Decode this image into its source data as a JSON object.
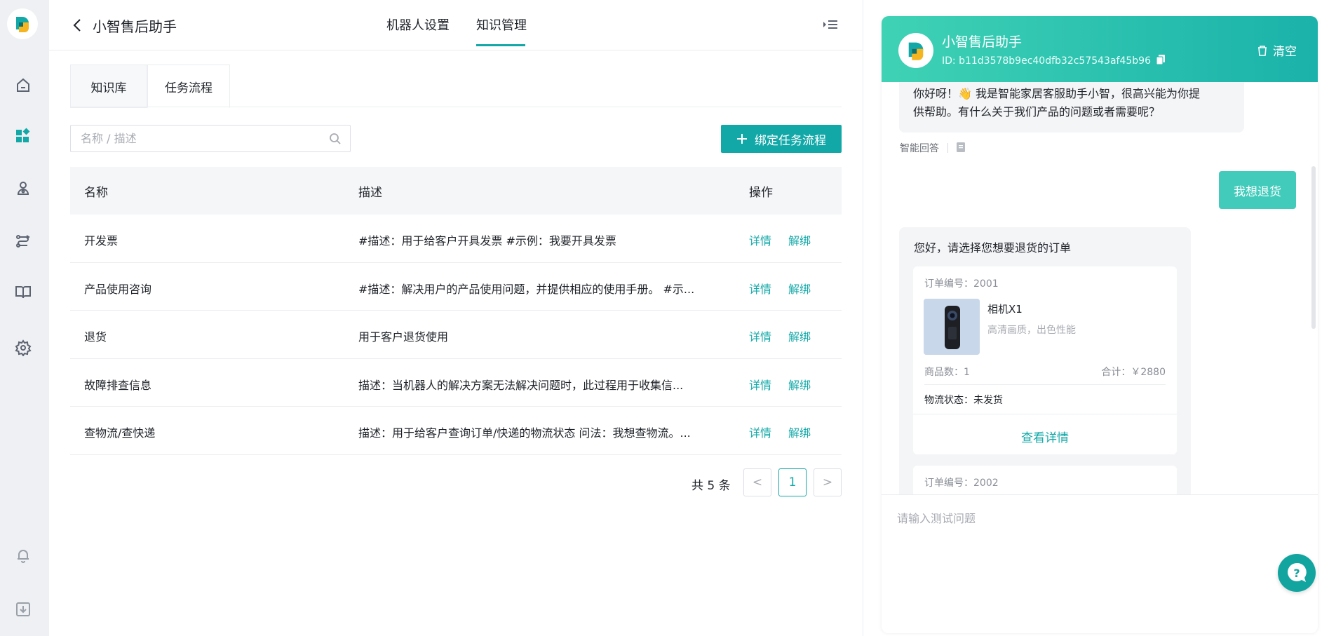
{
  "header": {
    "title": "小智售后助手",
    "tabs": [
      {
        "label": "机器人设置",
        "active": false
      },
      {
        "label": "知识管理",
        "active": true
      }
    ]
  },
  "sub_tabs": [
    {
      "label": "知识库",
      "active": false
    },
    {
      "label": "任务流程",
      "active": true
    }
  ],
  "search": {
    "placeholder": "名称 / 描述",
    "value": ""
  },
  "bind_button": {
    "label": "绑定任务流程"
  },
  "table": {
    "columns": {
      "name": "名称",
      "desc": "描述",
      "ops": "操作"
    },
    "rows": [
      {
        "name": "开发票",
        "desc": "#描述：用于给客户开具发票 #示例：我要开具发票",
        "detail": "详情",
        "unbind": "解绑"
      },
      {
        "name": "产品使用咨询",
        "desc": "#描述：解决用户的产品使用问题，并提供相应的使用手册。 #示...",
        "detail": "详情",
        "unbind": "解绑"
      },
      {
        "name": "退货",
        "desc": "用于客户退货使用",
        "detail": "详情",
        "unbind": "解绑"
      },
      {
        "name": "故障排查信息",
        "desc": "描述：当机器人的解决方案无法解决问题时，此过程用于收集信...",
        "detail": "详情",
        "unbind": "解绑"
      },
      {
        "name": "查物流/查快递",
        "desc": "描述：用于给客户查询订单/快递的物流状态 问法：我想查物流。...",
        "detail": "详情",
        "unbind": "解绑"
      }
    ]
  },
  "pagination": {
    "total_text": "共 5 条",
    "current_page": "1",
    "prev": "<",
    "next": ">"
  },
  "chat": {
    "bot_name": "小智售后助手",
    "bot_id": "ID: b11d3578b9ec40dfb32c57543af45b96",
    "clear_label": "清空",
    "greeting_line1": "你好呀！👋 我是智能家居客服助手小智，很高兴能为你提",
    "greeting_line2": "供帮助。有什么关于我们产品的问题或者需要呢？",
    "smart_reply_label": "智能回答",
    "user_message": "我想退货",
    "order_prompt": "您好，请选择您想要退货的订单",
    "orders": [
      {
        "order_no": "订单编号：2001",
        "product": "相机X1",
        "subtitle": "高清画质，出色性能",
        "count": "商品数：1",
        "total": "合计：￥2880",
        "status": "物流状态：未发货",
        "detail_link": "查看详情"
      },
      {
        "order_no": "订单编号：2002"
      }
    ],
    "input_placeholder": "请输入测试问题"
  },
  "colors": {
    "accent": "#13a8a8",
    "header_gradient_start": "#3fd2b5",
    "header_gradient_end": "#1ab2aa",
    "user_bubble": "#42cbbb"
  }
}
